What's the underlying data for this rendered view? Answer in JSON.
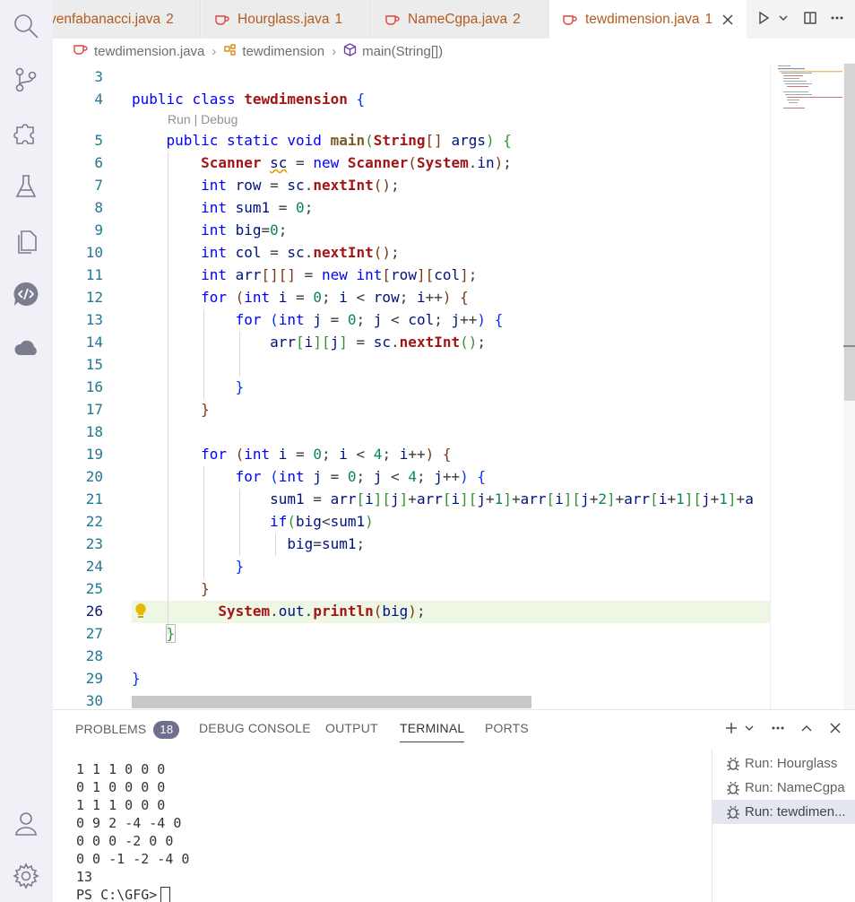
{
  "tabs": [
    {
      "name": "venfabanacci.java",
      "count": "2"
    },
    {
      "name": "Hourglass.java",
      "count": "1"
    },
    {
      "name": "NameCgpa.java",
      "count": "2"
    },
    {
      "name": "tewdimension.java",
      "count": "1"
    }
  ],
  "breadcrumb": {
    "file": "tewdimension.java",
    "class": "tewdimension",
    "method": "main(String[])"
  },
  "codelens": "Run | Debug",
  "line_numbers": [
    "3",
    "4",
    "5",
    "6",
    "7",
    "8",
    "9",
    "10",
    "11",
    "12",
    "13",
    "14",
    "15",
    "16",
    "17",
    "18",
    "19",
    "20",
    "21",
    "22",
    "23",
    "24",
    "25",
    "26",
    "27",
    "28",
    "29",
    "30"
  ],
  "panel": {
    "tabs": [
      "PROBLEMS",
      "DEBUG CONSOLE",
      "OUTPUT",
      "TERMINAL",
      "PORTS"
    ],
    "problems_count": "18"
  },
  "terminal_lines": [
    "1 1 1 0 0 0",
    "0 1 0 0 0 0",
    "1 1 1 0 0 0",
    "0 9 2 -4 -4 0",
    "0 0 0 -2 0 0",
    "0 0 -1 -2 -4 0",
    "13",
    "PS C:\\GFG>"
  ],
  "terminal_sessions": [
    "Run: Hourglass",
    "Run: NameCgpa",
    "Run: tewdimen..."
  ],
  "colors": {
    "accent": "#0000ff",
    "current_line": "#eef7e4",
    "tab_text": "#b45b1e"
  }
}
